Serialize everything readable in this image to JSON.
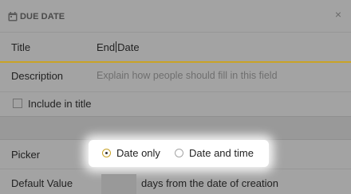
{
  "header": {
    "title": "DUE DATE",
    "icon": "calendar-icon",
    "close_icon": "close-icon",
    "close_glyph": "×"
  },
  "title_row": {
    "label": "Title",
    "value_before_caret": "End",
    "value_after_caret": "Date",
    "accent_color": "#c9a327"
  },
  "description_row": {
    "label": "Description",
    "placeholder": "Explain how people should fill in this field"
  },
  "include_row": {
    "label": "Include in title",
    "checked": false
  },
  "picker_row": {
    "label": "Picker",
    "options": [
      {
        "label": "Date only",
        "selected": true
      },
      {
        "label": "Date and time",
        "selected": false
      }
    ]
  },
  "default_row": {
    "label": "Default Value",
    "days_value": "",
    "suffix": "days from the date of creation"
  }
}
